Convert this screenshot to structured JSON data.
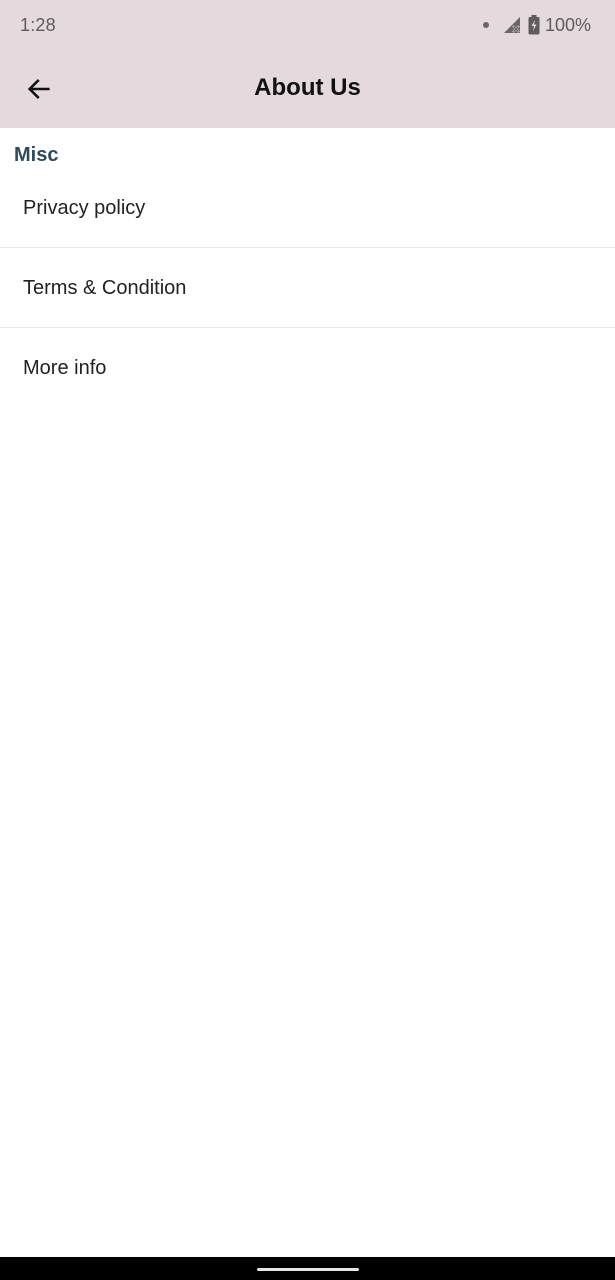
{
  "status_bar": {
    "time": "1:28",
    "battery_percent": "100%",
    "icons": [
      "notification-dot-icon",
      "signal-off-icon",
      "battery-charging-icon"
    ]
  },
  "app_bar": {
    "title": "About Us",
    "back_icon": "arrow-left-icon",
    "background_color": "#e4d9dc"
  },
  "section": {
    "title": "Misc",
    "title_color": "#2e4a5c",
    "items": [
      {
        "label": "Privacy policy"
      },
      {
        "label": "Terms & Condition"
      },
      {
        "label": "More info"
      }
    ]
  }
}
